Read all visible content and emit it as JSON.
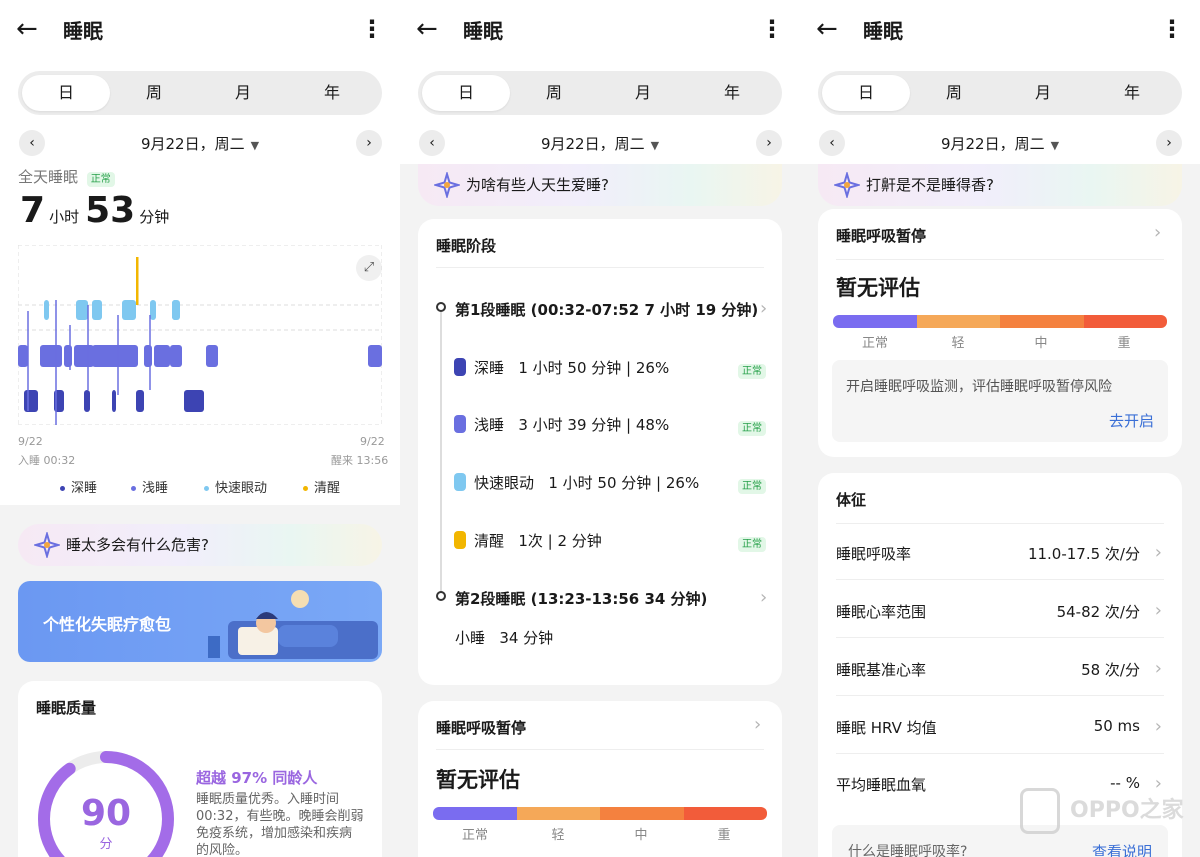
{
  "header": {
    "title": "睡眠"
  },
  "tabs": [
    "日",
    "周",
    "月",
    "年"
  ],
  "date": {
    "text": "9月22日，周二"
  },
  "panel1": {
    "label": "全天睡眠",
    "status": "正常",
    "hours": "7",
    "hours_unit": "小时",
    "minutes": "53",
    "minutes_unit": "分钟",
    "chart_start_date": "9/22",
    "chart_start_label": "入睡 00:32",
    "chart_end_date": "9/22",
    "chart_end_label": "醒来 13:56",
    "legend": [
      "深睡",
      "浅睡",
      "快速眼动",
      "清醒"
    ],
    "banner": "睡太多会有什么危害?",
    "promo": "个性化失眠疗愈包",
    "quality_title": "睡眠质量",
    "score": "90",
    "score_unit": "分",
    "beat": "超越 97% 同龄人",
    "comment_lines": [
      "睡眠质量优秀。入睡时间",
      "00:32，有些晚。晚睡会削弱",
      "免疫系统，增加感染和疾病",
      "的风险。"
    ]
  },
  "panel2": {
    "banner": "为啥有些人天生爱睡?",
    "stages_title": "睡眠阶段",
    "seg1": "第1段睡眠 (00:32-07:52  7 小时 19 分钟)",
    "stages": [
      {
        "name": "深睡",
        "detail": "1 小时 50 分钟 | 26%",
        "status": "正常"
      },
      {
        "name": "浅睡",
        "detail": "3 小时 39 分钟 | 48%",
        "status": "正常"
      },
      {
        "name": "快速眼动",
        "detail": "1 小时 50 分钟 | 26%",
        "status": "正常"
      },
      {
        "name": "清醒",
        "detail": "1次 |  2 分钟",
        "status": "正常"
      }
    ],
    "seg2": "第2段睡眠 (13:23-13:56  34 分钟)",
    "nap": "小睡",
    "nap_detail": "34 分钟",
    "apnea_title": "睡眠呼吸暂停",
    "apnea_value": "暂无评估",
    "scale": [
      "正常",
      "轻",
      "中",
      "重"
    ]
  },
  "panel3": {
    "banner": "打鼾是不是睡得香?",
    "apnea_title": "睡眠呼吸暂停",
    "apnea_value": "暂无评估",
    "scale": [
      "正常",
      "轻",
      "中",
      "重"
    ],
    "monitor_text": "开启睡眠呼吸监测，评估睡眠呼吸暂停风险",
    "monitor_link": "去开启",
    "vitals_title": "体征",
    "vitals": [
      {
        "label": "睡眠呼吸率",
        "value": "11.0-17.5 次/分"
      },
      {
        "label": "睡眠心率范围",
        "value": "54-82 次/分"
      },
      {
        "label": "睡眠基准心率",
        "value": "58 次/分"
      },
      {
        "label": "睡眠 HRV 均值",
        "value": "50 ms"
      },
      {
        "label": "平均睡眠血氧",
        "value": "-- %"
      }
    ],
    "faq_text": "什么是睡眠呼吸率?",
    "faq_link": "查看说明"
  },
  "watermark": "OPPO之家",
  "colors": {
    "deep": "#3d44b3",
    "light": "#6a6fe0",
    "rem": "#7fc8f0",
    "awake": "#f2b600",
    "accent": "#3a6fd6",
    "ok_green": "#27a04a",
    "scale": [
      "#7a6cf0",
      "#f5a858",
      "#f4813f",
      "#f25c3a"
    ]
  },
  "icons": [
    "back-arrow-icon",
    "more-icon",
    "chevron-left-icon",
    "chevron-right-icon",
    "caret-down-icon",
    "expand-icon",
    "chevron-icon",
    "ai-star-icon"
  ]
}
